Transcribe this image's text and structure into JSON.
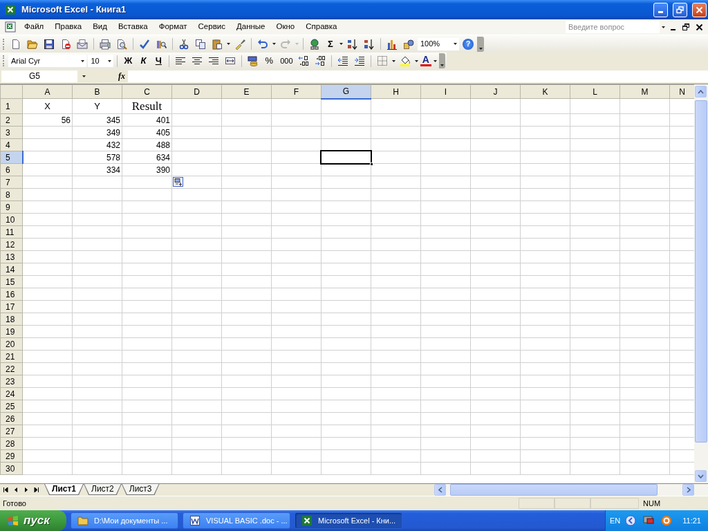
{
  "window": {
    "title": "Microsoft Excel - Книга1"
  },
  "menu": [
    "Файл",
    "Правка",
    "Вид",
    "Вставка",
    "Формат",
    "Сервис",
    "Данные",
    "Окно",
    "Справка"
  ],
  "help_box": {
    "placeholder": "Введите вопрос"
  },
  "standard_toolbar": {
    "autosum": "Σ",
    "zoom": "100%",
    "help": "?"
  },
  "formatting_toolbar": {
    "font": "Arial Cyr",
    "size": "10",
    "bold": "Ж",
    "italic": "К",
    "underline": "Ч",
    "percent": "%",
    "thousands": "000",
    "font_color": "A"
  },
  "formula_bar": {
    "name_box": "G5",
    "function_label": "fx"
  },
  "sheet": {
    "columns": [
      {
        "label": "A",
        "selected": false
      },
      {
        "label": "B",
        "selected": false
      },
      {
        "label": "C",
        "selected": false
      },
      {
        "label": "D",
        "selected": false
      },
      {
        "label": "E",
        "selected": false
      },
      {
        "label": "F",
        "selected": false
      },
      {
        "label": "G",
        "selected": true
      },
      {
        "label": "H",
        "selected": false
      },
      {
        "label": "I",
        "selected": false
      },
      {
        "label": "J",
        "selected": false
      },
      {
        "label": "K",
        "selected": false
      },
      {
        "label": "L",
        "selected": false
      },
      {
        "label": "M",
        "selected": false
      },
      {
        "label": "N",
        "selected": false
      }
    ],
    "rows": [
      {
        "label": "1",
        "selected": false,
        "cells": [
          {
            "text": "X",
            "centered": true
          },
          {
            "text": "Y",
            "centered": true
          },
          {
            "text": "Result",
            "centered": true,
            "serif": true
          }
        ]
      },
      {
        "label": "2",
        "selected": false,
        "cells": [
          {
            "text": "56"
          },
          {
            "text": "345"
          },
          {
            "text": "401"
          }
        ]
      },
      {
        "label": "3",
        "selected": false,
        "cells": [
          null,
          {
            "text": "349"
          },
          {
            "text": "405"
          }
        ]
      },
      {
        "label": "4",
        "selected": false,
        "cells": [
          null,
          {
            "text": "432"
          },
          {
            "text": "488"
          }
        ]
      },
      {
        "label": "5",
        "selected": true,
        "cells": [
          null,
          {
            "text": "578"
          },
          {
            "text": "634"
          }
        ]
      },
      {
        "label": "6",
        "selected": false,
        "cells": [
          null,
          {
            "text": "334"
          },
          {
            "text": "390"
          }
        ]
      },
      {
        "label": "7",
        "selected": false,
        "paste_options": true
      },
      {
        "label": "8",
        "selected": false
      },
      {
        "label": "9",
        "selected": false
      },
      {
        "label": "10",
        "selected": false
      },
      {
        "label": "11",
        "selected": false
      },
      {
        "label": "12",
        "selected": false
      },
      {
        "label": "13",
        "selected": false
      },
      {
        "label": "14",
        "selected": false
      },
      {
        "label": "15",
        "selected": false
      },
      {
        "label": "16",
        "selected": false
      },
      {
        "label": "17",
        "selected": false
      },
      {
        "label": "18",
        "selected": false
      },
      {
        "label": "19",
        "selected": false
      },
      {
        "label": "20",
        "selected": false
      },
      {
        "label": "21",
        "selected": false
      },
      {
        "label": "22",
        "selected": false
      },
      {
        "label": "23",
        "selected": false
      },
      {
        "label": "24",
        "selected": false
      },
      {
        "label": "25",
        "selected": false
      },
      {
        "label": "26",
        "selected": false
      },
      {
        "label": "27",
        "selected": false
      },
      {
        "label": "28",
        "selected": false
      },
      {
        "label": "29",
        "selected": false
      },
      {
        "label": "30",
        "selected": false
      }
    ]
  },
  "sheet_tabs": [
    {
      "label": "Лист1",
      "selected": true
    },
    {
      "label": "Лист2",
      "selected": false
    },
    {
      "label": "Лист3",
      "selected": false
    }
  ],
  "status_bar": {
    "text": "Готово",
    "indicator": "NUM"
  },
  "taskbar": {
    "start": "пуск",
    "tasks": [
      {
        "label": "D:\\Мои документы ...",
        "kind": "folder",
        "selected": false
      },
      {
        "label": "VISUAL BASIC .doc - ...",
        "kind": "word",
        "selected": false
      },
      {
        "label": "Microsoft Excel - Кни...",
        "kind": "excel",
        "selected": true
      }
    ],
    "language": "EN",
    "clock": "11:21"
  }
}
